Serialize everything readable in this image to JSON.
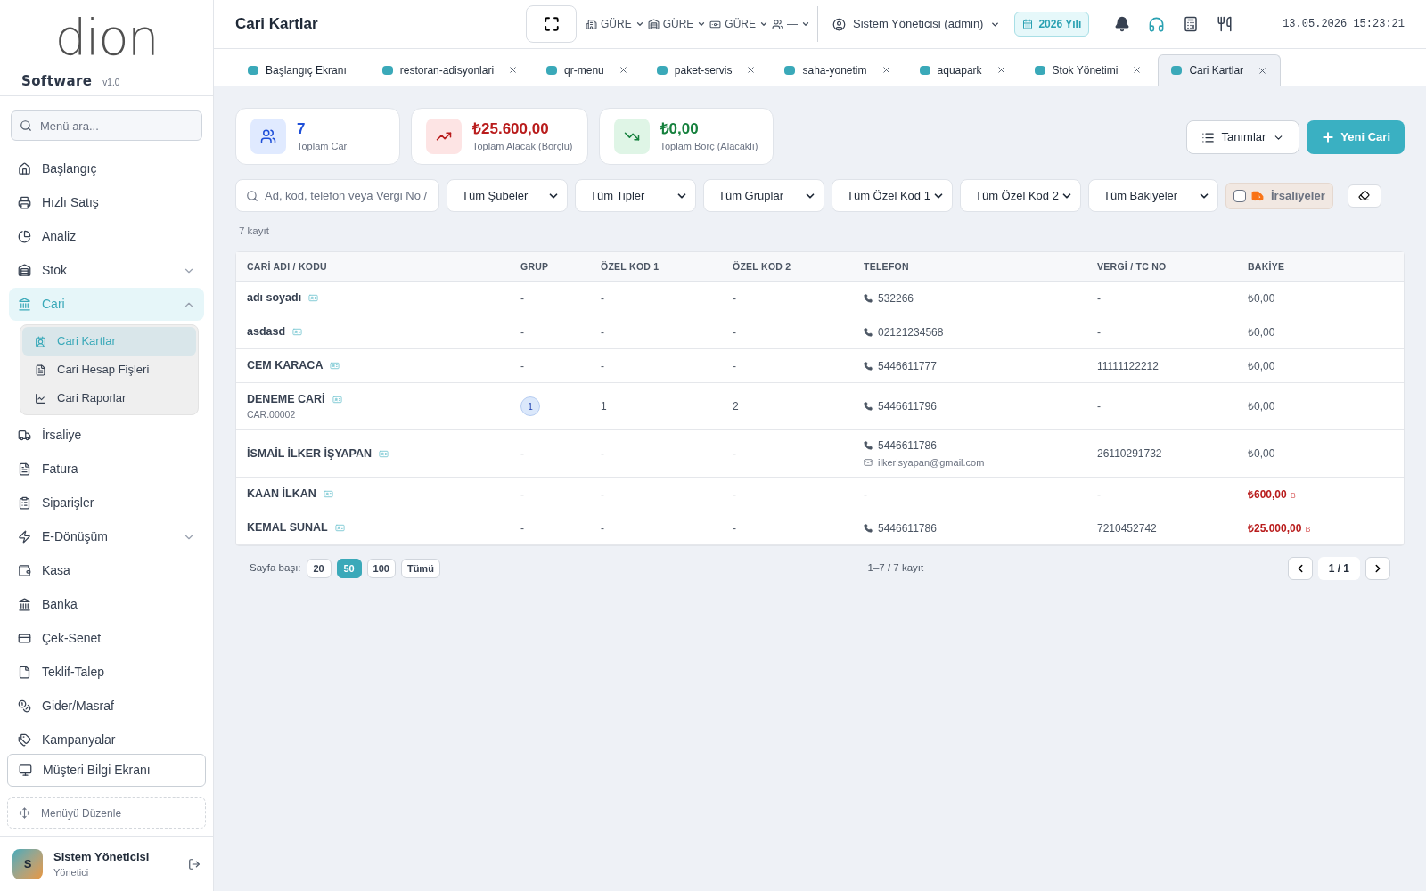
{
  "logo": {
    "text": "dion",
    "subtitle": "Software",
    "version": "v1.0"
  },
  "menu_search": {
    "placeholder": "Menü ara..."
  },
  "sidebar": {
    "items": [
      {
        "label": "Başlangıç",
        "kind": "link",
        "selected": false
      },
      {
        "label": "Hızlı Satış",
        "kind": "link",
        "selected": false
      },
      {
        "label": "Analiz",
        "kind": "link",
        "selected": false
      },
      {
        "label": "Stok",
        "kind": "group",
        "selected": false,
        "expanded": false
      },
      {
        "label": "Cari",
        "kind": "group",
        "selected": true,
        "expanded": true,
        "children": [
          {
            "label": "Cari Kartlar",
            "selected": true
          },
          {
            "label": "Cari Hesap Fişleri",
            "selected": false
          },
          {
            "label": "Cari Raporlar",
            "selected": false
          }
        ]
      },
      {
        "label": "İrsaliye",
        "kind": "link",
        "selected": false
      },
      {
        "label": "Fatura",
        "kind": "link",
        "selected": false
      },
      {
        "label": "Siparişler",
        "kind": "link",
        "selected": false
      },
      {
        "label": "E-Dönüşüm",
        "kind": "group",
        "selected": false,
        "expanded": false
      },
      {
        "label": "Kasa",
        "kind": "link",
        "selected": false
      },
      {
        "label": "Banka",
        "kind": "link",
        "selected": false
      },
      {
        "label": "Çek-Senet",
        "kind": "link",
        "selected": false
      },
      {
        "label": "Teklif-Talep",
        "kind": "link",
        "selected": false
      },
      {
        "label": "Gider/Masraf",
        "kind": "link",
        "selected": false
      },
      {
        "label": "Kampanyalar",
        "kind": "link",
        "selected": false
      }
    ],
    "screen_button": "Müşteri Bilgi Ekranı",
    "edit_menu": "Menüyü Düzenle",
    "user": {
      "initial": "S",
      "name": "Sistem Yöneticisi",
      "role": "Yönetici"
    }
  },
  "header": {
    "title": "Cari Kartlar",
    "selectors": [
      {
        "label": "GÜRE"
      },
      {
        "label": "GÜRE"
      },
      {
        "label": "GÜRE"
      },
      {
        "label": "—"
      }
    ],
    "user": "Sistem Yöneticisi (admin)",
    "year": "2026 Yılı",
    "datetime": "13.05.2026 15:23:21"
  },
  "tabs": [
    {
      "label": "Başlangıç Ekranı",
      "selected": false,
      "closable": false
    },
    {
      "label": "restoran-adisyonlari",
      "selected": false,
      "closable": true
    },
    {
      "label": "qr-menu",
      "selected": false,
      "closable": true
    },
    {
      "label": "paket-servis",
      "selected": false,
      "closable": true
    },
    {
      "label": "saha-yonetim",
      "selected": false,
      "closable": true
    },
    {
      "label": "aquapark",
      "selected": false,
      "closable": true
    },
    {
      "label": "Stok Yönetimi",
      "selected": false,
      "closable": true
    },
    {
      "label": "Cari Kartlar",
      "selected": true,
      "closable": true
    }
  ],
  "stats": [
    {
      "value": "7",
      "label": "Toplam Cari",
      "color": "#1d4ed8"
    },
    {
      "value": "₺25.600,00",
      "label": "Toplam Alacak (Borçlu)",
      "color": "#b91c1c"
    },
    {
      "value": "₺0,00",
      "label": "Toplam Borç (Alacaklı)",
      "color": "#15803d"
    }
  ],
  "actions": {
    "definitions": "Tanımlar",
    "new": "Yeni Cari"
  },
  "filters": {
    "search_placeholder": "Ad, kod, telefon veya Vergi No /",
    "selects": [
      "Tüm Şubeler",
      "Tüm Tipler",
      "Tüm Gruplar",
      "Tüm Özel Kod 1",
      "Tüm Özel Kod 2",
      "Tüm Bakiyeler"
    ],
    "waybill": {
      "label": "İrsaliyeler",
      "checked": false
    }
  },
  "record_count": "7 kayıt",
  "table": {
    "columns": [
      "CARİ ADI / KODU",
      "GRUP",
      "ÖZEL KOD 1",
      "ÖZEL KOD 2",
      "TELEFON",
      "VERGİ / TC NO",
      "BAKİYE"
    ],
    "rows": [
      {
        "name": "adı soyadı",
        "group": {
          "text": "-",
          "kind": "plain"
        },
        "code1": "-",
        "code2": "-",
        "contact": [
          {
            "kind": "phone",
            "text": "532266"
          }
        ],
        "tax": "-",
        "balance": {
          "text": "₺0,00",
          "owed": false
        }
      },
      {
        "name": "asdasd",
        "group": {
          "text": "-",
          "kind": "plain"
        },
        "code1": "-",
        "code2": "-",
        "contact": [
          {
            "kind": "phone",
            "text": "02121234568"
          }
        ],
        "tax": "-",
        "balance": {
          "text": "₺0,00",
          "owed": false
        }
      },
      {
        "name": "CEM KARACA",
        "group": {
          "text": "-",
          "kind": "plain"
        },
        "code1": "-",
        "code2": "-",
        "contact": [
          {
            "kind": "phone",
            "text": "5446611777"
          }
        ],
        "tax": "11111122212",
        "balance": {
          "text": "₺0,00",
          "owed": false
        }
      },
      {
        "name": "DENEME CARİ",
        "code": "CAR.00002",
        "group": {
          "text": "1",
          "kind": "badge"
        },
        "code1": "1",
        "code2": "2",
        "contact": [
          {
            "kind": "phone",
            "text": "5446611796"
          }
        ],
        "tax": "-",
        "balance": {
          "text": "₺0,00",
          "owed": false
        }
      },
      {
        "name": "İSMAİL İLKER İŞYAPAN",
        "group": {
          "text": "-",
          "kind": "plain"
        },
        "code1": "-",
        "code2": "-",
        "contact": [
          {
            "kind": "phone",
            "text": "5446611786"
          },
          {
            "kind": "email",
            "text": "ilkerisyapan@gmail.com"
          }
        ],
        "tax": "26110291732",
        "balance": {
          "text": "₺0,00",
          "owed": false
        }
      },
      {
        "name": "KAAN İLKAN",
        "group": {
          "text": "-",
          "kind": "plain"
        },
        "code1": "-",
        "code2": "-",
        "contact": [
          {
            "kind": "none",
            "text": "-"
          }
        ],
        "tax": "-",
        "balance": {
          "text": "₺600,00",
          "owed": true,
          "suffix": "B"
        }
      },
      {
        "name": "KEMAL SUNAL",
        "group": {
          "text": "-",
          "kind": "plain"
        },
        "code1": "-",
        "code2": "-",
        "contact": [
          {
            "kind": "phone",
            "text": "5446611786"
          }
        ],
        "tax": "7210452742",
        "balance": {
          "text": "₺25.000,00",
          "owed": true,
          "suffix": "B"
        }
      }
    ]
  },
  "pagination": {
    "label": "Sayfa başı:",
    "sizes": [
      {
        "label": "20",
        "selected": false
      },
      {
        "label": "50",
        "selected": true
      },
      {
        "label": "100",
        "selected": false
      },
      {
        "label": "Tümü",
        "selected": false
      }
    ],
    "summary": "1–7 / 7 kayıt",
    "page": "1 / 1"
  }
}
